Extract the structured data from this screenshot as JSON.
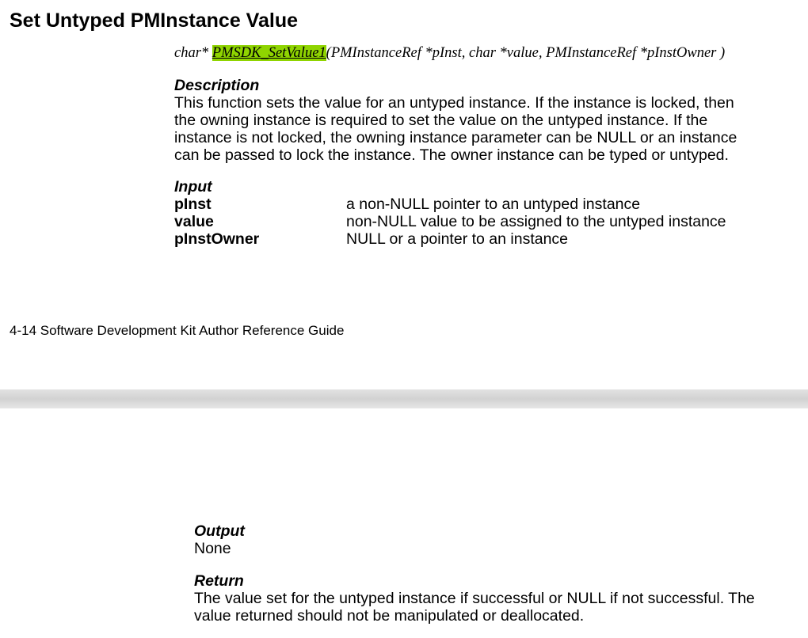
{
  "page1": {
    "title": "Set Untyped PMInstance Value",
    "signature": {
      "prefix": "char* ",
      "function_name": "PMSDK_SetValue1",
      "params": "(PMInstanceRef *pInst, char *value, PMInstanceRef *pInstOwner )"
    },
    "description": {
      "label": "Description",
      "lines": [
        "This function sets the value for an untyped instance.  If the instance is locked, then",
        "the owning instance is required to set the value on the untyped instance.  If the",
        "instance is not locked, the owning instance parameter can be NULL or an instance",
        "can be passed to lock the instance.  The owner instance can be typed or untyped."
      ]
    },
    "input": {
      "label": "Input",
      "params": [
        {
          "name": "pInst",
          "desc": "a non-NULL pointer to an untyped instance"
        },
        {
          "name": "value",
          "desc": "non-NULL value to be assigned to the untyped instance"
        },
        {
          "name": "pInstOwner",
          "desc": "NULL or a pointer to an instance"
        }
      ]
    },
    "footer": "4-14 Software Development Kit Author Reference Guide"
  },
  "page2": {
    "output": {
      "label": "Output",
      "text": "None"
    },
    "return": {
      "label": "Return",
      "lines": [
        "The value set for the untyped instance if successful or NULL if not successful.  The",
        "value returned should not be manipulated or deallocated."
      ]
    }
  },
  "colors": {
    "highlight": "#8fd400",
    "page_gap": "#d6d6d6"
  }
}
